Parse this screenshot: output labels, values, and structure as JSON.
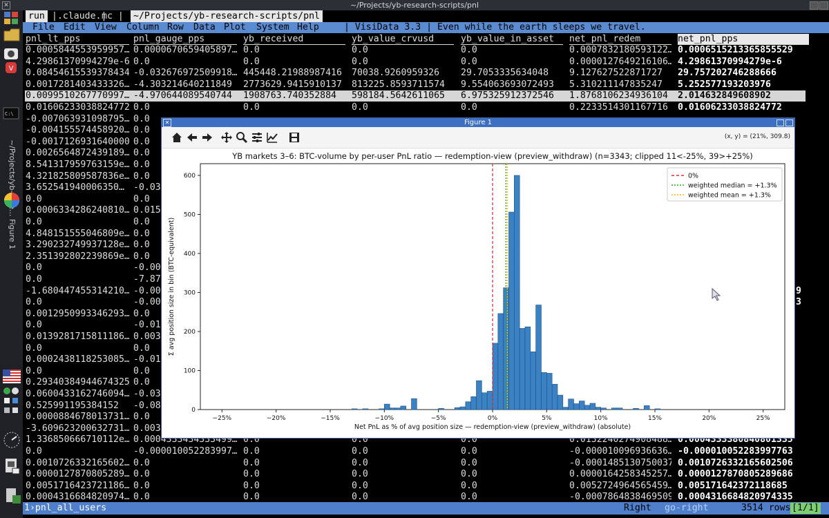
{
  "window": {
    "title": "~/Projects/yb-research-scripts/pnl"
  },
  "dock": {
    "vertical_title": "~/Projects/yb-rese... Figure 1"
  },
  "tabs": [
    {
      "label": "run",
      "active": true
    },
    {
      "label": ".claude.",
      "active": false
    },
    {
      "label": "mc",
      "active": false
    },
    {
      "label": "~/Projects/yb-research-scripts/pnl",
      "active": true
    }
  ],
  "menu": {
    "items": [
      "File",
      "Edit",
      "View",
      "Column",
      "Row",
      "Data",
      "Plot",
      "System",
      "Help"
    ],
    "message": "| VisiData 3.3 | Even while the earth sleeps we travel."
  },
  "table": {
    "columns": [
      "pnl_lt_pps",
      "pnl_gauge_pps",
      "yb_received",
      "yb_value_crvusd",
      "yb_value_in_asset",
      "net_pnl_redem",
      "net_pnl_pps"
    ],
    "selected_column": 6,
    "selected_row": 4,
    "rows": [
      [
        "0.0005844553959957…",
        "0.0000670659405897…",
        "0.0",
        "0.0",
        "0.0",
        "0.0007832180593122…",
        "0.0006515213365855529"
      ],
      [
        "4.29861370994279e-6",
        "0.0",
        "0.0",
        "0.0",
        "0.0",
        "0.0000127649216106…",
        "4.29861370994279e-6"
      ],
      [
        "0.08454615539378434",
        "-0.032676972509918…",
        "445448.21988987416",
        "70038.9260959326",
        "29.7053335634048",
        "9.127627522871727",
        "29.757202746288666"
      ],
      [
        "0.0017281403433326…",
        "-4.303214640211849",
        "2773629.9415910137",
        "813225.8593711574",
        "9.554063693072493",
        "5.310211147835247",
        "5.252577193203976"
      ],
      [
        "0.0099510267770997…",
        "-4.970644089540744",
        "1908763.740352884",
        "598184.5642611065",
        "6.975325912372546",
        "1.8768106234936104",
        "2.014632849608902"
      ],
      [
        "0.01606233038824772",
        "0.0",
        "0.0",
        "0.0",
        "0.0",
        "0.2233514301167716",
        "0.01606233038824772"
      ],
      [
        "-0.007063931098795…",
        "0.0",
        "",
        "",
        "",
        "",
        ""
      ],
      [
        "-0.004155574458920…",
        "0.0",
        "",
        "",
        "",
        "",
        ""
      ],
      [
        "-0.0017126931640000…",
        "0.0",
        "",
        "",
        "",
        "",
        ""
      ],
      [
        "0.0026564872439189…",
        "0.0",
        "",
        "",
        "",
        "",
        ""
      ],
      [
        "8.541317959763159e…",
        "0.0",
        "",
        "",
        "",
        "",
        ""
      ],
      [
        "4.321825809587836e…",
        "0.0",
        "",
        "",
        "",
        "",
        ""
      ],
      [
        "3.652541940006350…",
        "-0.03",
        "",
        "",
        "",
        "",
        ""
      ],
      [
        "0.0",
        "0.0",
        "",
        "",
        "",
        "",
        ""
      ],
      [
        "0.0006334286240810…",
        "0.015",
        "",
        "",
        "",
        "",
        ""
      ],
      [
        "0.0",
        "0.0",
        "",
        "",
        "",
        "",
        ""
      ],
      [
        "4.848151555046809e…",
        "0.0",
        "",
        "",
        "",
        "",
        ""
      ],
      [
        "3.290232749937128e…",
        "0.0",
        "",
        "",
        "",
        "",
        ""
      ],
      [
        "2.351392802239869e…",
        "0.0",
        "",
        "",
        "",
        "",
        ""
      ],
      [
        "0.0",
        "-0.00",
        "",
        "",
        "",
        "",
        ""
      ],
      [
        "0.0",
        "-7.87",
        "",
        "",
        "",
        "",
        ""
      ],
      [
        "-1.680447455314210…",
        "-0.00",
        "",
        "",
        "",
        "",
        ""
      ],
      [
        "0.0",
        "-0.00",
        "",
        "",
        "",
        "",
        ""
      ],
      [
        "0.0012950993346293…",
        "0.0",
        "",
        "",
        "",
        "",
        ""
      ],
      [
        "0.0",
        "-0.01",
        "",
        "",
        "",
        "",
        ""
      ],
      [
        "0.0139281715811186…",
        "0.003",
        "",
        "",
        "",
        "",
        ""
      ],
      [
        "0.0",
        "0.0",
        "",
        "",
        "",
        "",
        ""
      ],
      [
        "0.0002438118253085…",
        "-0.01",
        "",
        "",
        "",
        "",
        ""
      ],
      [
        "0.0",
        "0.0",
        "",
        "",
        "",
        "",
        ""
      ],
      [
        "0.29340384944674325",
        "0.0",
        "",
        "",
        "",
        "",
        ""
      ],
      [
        "0.0600433162746094…",
        "-0.03",
        "",
        "",
        "",
        "",
        ""
      ],
      [
        "0.525991195384152",
        "-0.08",
        "",
        "",
        "",
        "",
        ""
      ],
      [
        "0.0000884678013731…",
        "0.0",
        "",
        "",
        "",
        "",
        ""
      ],
      [
        "-3.609623200632731…",
        "0.003",
        "",
        "",
        "",
        "",
        ""
      ],
      [
        "1.336850666710112e…",
        "0.0004333434333499…",
        "0.0",
        "0.0",
        "0.0",
        "0.0132240274908488…",
        "0.0004333380840801335"
      ],
      [
        "0.0",
        "-0.000010052283997…",
        "0.0",
        "0.0",
        "0.0",
        "-0.000010096936636…",
        "-0.000010052283997763"
      ],
      [
        "0.0010726332165602…",
        "0.0",
        "0.0",
        "0.0",
        "0.0",
        "-0.0001485130750037…",
        "0.0010726332165602506"
      ],
      [
        "0.0000127870805289…",
        "0.0",
        "0.0",
        "0.0",
        "0.0",
        "0.0000164258345257…",
        "0.0000127870805289686"
      ],
      [
        "0.0051716423721186…",
        "0.0",
        "0.0",
        "0.0",
        "0.0",
        "0.0052724964565459…",
        "0.005171642372118685"
      ],
      [
        "0.0004316684820974…",
        "0.0",
        "0.0",
        "0.0",
        "0.0",
        "-0.0007864838469509…",
        "0.0004316684820974335"
      ]
    ],
    "right_edge_fragments": [
      "9",
      "3"
    ]
  },
  "statusbar": {
    "prompt": "1›pnl_all_users",
    "keystroke": "Right",
    "command": "go-right",
    "row_count": "3514 rows",
    "page": "[1/1]"
  },
  "figure": {
    "window_title": "Figure 1",
    "coords": "(x, y) = (21%, 309.8)",
    "toolbar_icons": [
      "home-icon",
      "back-arrow-icon",
      "forward-arrow-icon",
      "pan-icon",
      "zoom-icon",
      "configure-subplots-icon",
      "edit-axis-icon",
      "save-icon"
    ],
    "colors": {
      "bar": "#3b82c4",
      "zero_line": "#e03030",
      "median_line": "#2ca02c",
      "mean_line": "#ffb000",
      "titlebar": "#3c6fc1"
    }
  },
  "chart_data": {
    "type": "bar",
    "title": "YB markets 3–6: BTC-volume by per-user PnL ratio — redemption-view (preview_withdraw)  (n=3343; clipped 11<-25%, 39>+25%)",
    "xlabel": "Net PnL as % of avg position size — redemption-view (preview_withdraw)  (absolute)",
    "ylabel": "Σ avg position size in bin  (BTC-equivalent)",
    "xlim": [
      -27,
      27
    ],
    "ylim": [
      0,
      630
    ],
    "xticks": [
      -25,
      -20,
      -15,
      -10,
      -5,
      0,
      5,
      10,
      15,
      20,
      25
    ],
    "xtick_labels": [
      "−25%",
      "−20%",
      "−15%",
      "−10%",
      "−5%",
      "0%",
      "5%",
      "10%",
      "15%",
      "20%",
      "25%"
    ],
    "yticks": [
      0,
      100,
      200,
      300,
      400,
      500,
      600
    ],
    "bin_width": 0.5,
    "bins": [
      {
        "x": -13,
        "y": 2
      },
      {
        "x": -12,
        "y": 2
      },
      {
        "x": -10.5,
        "y": 2
      },
      {
        "x": -10,
        "y": 14
      },
      {
        "x": -9.5,
        "y": 4
      },
      {
        "x": -9,
        "y": 4
      },
      {
        "x": -8.5,
        "y": 9
      },
      {
        "x": -7.5,
        "y": 28
      },
      {
        "x": -5,
        "y": 3
      },
      {
        "x": -3.5,
        "y": 5
      },
      {
        "x": -3,
        "y": 7
      },
      {
        "x": -2.5,
        "y": 20
      },
      {
        "x": -2,
        "y": 33
      },
      {
        "x": -1.5,
        "y": 74
      },
      {
        "x": -1,
        "y": 43
      },
      {
        "x": -0.5,
        "y": 47
      },
      {
        "x": 0,
        "y": 170
      },
      {
        "x": 0.5,
        "y": 246
      },
      {
        "x": 1,
        "y": 312
      },
      {
        "x": 1.5,
        "y": 506
      },
      {
        "x": 2,
        "y": 600
      },
      {
        "x": 2.5,
        "y": 208
      },
      {
        "x": 3,
        "y": 212
      },
      {
        "x": 3.5,
        "y": 148
      },
      {
        "x": 4,
        "y": 268
      },
      {
        "x": 4.5,
        "y": 95
      },
      {
        "x": 5,
        "y": 93
      },
      {
        "x": 5.5,
        "y": 65
      },
      {
        "x": 6,
        "y": 37
      },
      {
        "x": 6.5,
        "y": 6
      },
      {
        "x": 7,
        "y": 27
      },
      {
        "x": 7.5,
        "y": 15
      },
      {
        "x": 8,
        "y": 22
      },
      {
        "x": 8.5,
        "y": 11
      },
      {
        "x": 9,
        "y": 16
      },
      {
        "x": 9.5,
        "y": 6
      },
      {
        "x": 10,
        "y": 4
      },
      {
        "x": 11,
        "y": 4
      },
      {
        "x": 11.5,
        "y": 4
      },
      {
        "x": 13,
        "y": 3
      },
      {
        "x": 14,
        "y": 10
      },
      {
        "x": 15,
        "y": 2
      }
    ],
    "vlines": [
      {
        "name": "0%",
        "x": 0,
        "style": "dashed",
        "color": "#e03030"
      },
      {
        "name": "weighted median = +1.3%",
        "x": 1.3,
        "style": "dotted",
        "color": "#2ca02c"
      },
      {
        "name": "weighted mean = +1.3%",
        "x": 1.3,
        "style": "dotted",
        "color": "#ffb000"
      }
    ],
    "legend": {
      "placement": "top-right",
      "entries": [
        "0%",
        "weighted median = +1.3%",
        "weighted mean = +1.3%"
      ]
    },
    "grid": false
  }
}
